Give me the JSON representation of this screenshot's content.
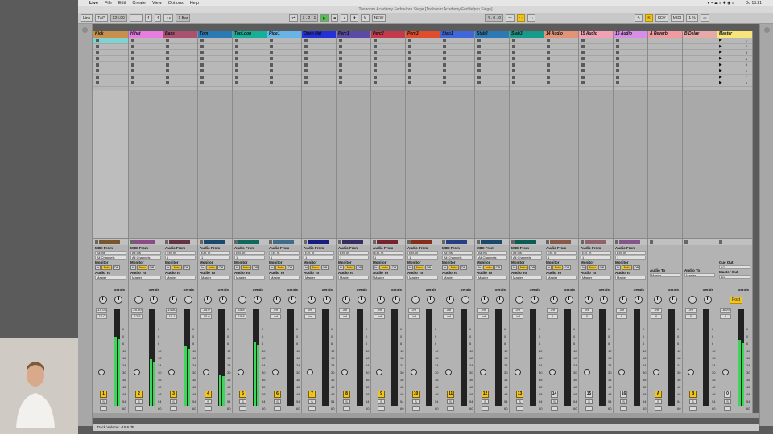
{
  "macbar": {
    "app": "Live",
    "menus": [
      "File",
      "Edit",
      "Create",
      "View",
      "Options",
      "Help"
    ],
    "clock": "Do 13:21"
  },
  "window_title": "Toolroom Academy Fedde/pro Siege [Toolroom Academy Fedde/pro Siege]",
  "toolbar": {
    "link": "Link",
    "tap": "TAP",
    "tempo": "124.00",
    "sig_num": "4",
    "sig_den": "4",
    "quant": "1 Bar",
    "pos": "3 . 2 . 1",
    "new": "NEW",
    "pos2": "4 . 0 . 0",
    "key": "KEY",
    "midi": "MIDI",
    "cpu": "1 %"
  },
  "colors": {
    "accent": "#f2c41f",
    "meter": "#3bd65a"
  },
  "tracks": [
    {
      "name": "Kick",
      "color": "#c8904c",
      "num": "1",
      "vol": "-10.03",
      "peak": "-10.0",
      "lvl": 0.72,
      "type": "midi",
      "from": "MIDI From",
      "sel": "All Ins",
      "ch": "All Channels"
    },
    {
      "name": "Hihat",
      "color": "#e77de0",
      "num": "2",
      "vol": "-20.30",
      "peak": "-12.5",
      "lvl": 0.48,
      "type": "midi",
      "from": "MIDI From",
      "sel": "All Ins",
      "ch": "All Channels"
    },
    {
      "name": "Bass",
      "color": "#a9516f",
      "num": "3",
      "vol": "-14.80",
      "peak": "-15.1",
      "lvl": 0.62,
      "type": "audio",
      "from": "Audio From",
      "sel": "Ext. In",
      "ch": "1"
    },
    {
      "name": "Tom",
      "color": "#2a7ab5",
      "num": "4",
      "vol": "-15.0",
      "peak": "-15.0",
      "lvl": 0.32,
      "type": "audio",
      "from": "Audio From",
      "sel": "Ext. In",
      "ch": "1"
    },
    {
      "name": "TopLoop",
      "color": "#16b098",
      "num": "5",
      "vol": "-15.8",
      "peak": "-15.8",
      "lvl": 0.66,
      "type": "audio",
      "from": "Audio From",
      "sel": "Ext. In",
      "ch": "1"
    },
    {
      "name": "Ride1",
      "color": "#67b4e8",
      "num": "6",
      "vol": "-inf",
      "peak": "-inf",
      "lvl": 0,
      "type": "audio",
      "from": "Audio From",
      "sel": "Ext. In",
      "ch": "1"
    },
    {
      "name": "Open Hat",
      "color": "#2431d6",
      "num": "7",
      "vol": "-inf",
      "peak": "-inf",
      "lvl": 0,
      "type": "audio",
      "from": "Audio From",
      "sel": "Ext. In",
      "ch": "1"
    },
    {
      "name": "Perc1",
      "color": "#5a4aa6",
      "num": "8",
      "vol": "-inf",
      "peak": "-inf",
      "lvl": 0,
      "type": "audio",
      "from": "Audio From",
      "sel": "Ext. In",
      "ch": "1"
    },
    {
      "name": "Perc2",
      "color": "#c33a4b",
      "num": "9",
      "vol": "-inf",
      "peak": "-inf",
      "lvl": 0,
      "type": "audio",
      "from": "Audio From",
      "sel": "Ext. In",
      "ch": "1"
    },
    {
      "name": "Perc3",
      "color": "#e14d2c",
      "num": "10",
      "vol": "-inf",
      "peak": "-inf",
      "lvl": 0,
      "type": "audio",
      "from": "Audio From",
      "sel": "Ext. In",
      "ch": "1"
    },
    {
      "name": "Stab1",
      "color": "#3f67d9",
      "num": "11",
      "vol": "-inf",
      "peak": "-inf",
      "lvl": 0,
      "type": "midi",
      "from": "MIDI From",
      "sel": "All Ins",
      "ch": "All Channels"
    },
    {
      "name": "Stab2",
      "color": "#2a7ab5",
      "num": "12",
      "vol": "-inf",
      "peak": "-inf",
      "lvl": 0,
      "type": "midi",
      "from": "MIDI From",
      "sel": "All Ins",
      "ch": "All Channels"
    },
    {
      "name": "Stab3",
      "color": "#169a8c",
      "num": "13",
      "vol": "-inf",
      "peak": "-inf",
      "lvl": 0,
      "type": "midi",
      "from": "MIDI From",
      "sel": "All Ins",
      "ch": "All Channels"
    },
    {
      "name": "14 Audio",
      "color": "#e39478",
      "num": "14",
      "vol": "-inf",
      "peak": "0",
      "lvl": 0,
      "type": "audio",
      "from": "Audio From",
      "sel": "Ext. In",
      "ch": "1",
      "grey": true
    },
    {
      "name": "15 Audio",
      "color": "#f2a1b4",
      "num": "15",
      "vol": "-inf",
      "peak": "0",
      "lvl": 0,
      "type": "audio",
      "from": "Audio From",
      "sel": "Ext. In",
      "ch": "1",
      "grey": true
    },
    {
      "name": "16 Audio",
      "color": "#d88de8",
      "num": "16",
      "vol": "-inf",
      "peak": "0",
      "lvl": 0,
      "type": "audio",
      "from": "Audio From",
      "sel": "Ext. In",
      "ch": "1",
      "grey": true
    },
    {
      "name": "A Reverb",
      "color": "#f09aa0",
      "num": "A",
      "vol": "-inf",
      "peak": "0",
      "lvl": 0,
      "type": "return"
    },
    {
      "name": "B Delay",
      "color": "#e8a9a9",
      "num": "B",
      "vol": "-inf",
      "peak": "0",
      "lvl": 0,
      "type": "return"
    },
    {
      "name": "Master",
      "color": "#f7e47a",
      "num": "0",
      "vol": "-6.09",
      "peak": "0",
      "lvl": 0.68,
      "type": "master"
    }
  ],
  "labels": {
    "monitor": "Monitor",
    "audio_to": "Audio To",
    "midi_to": "MIDI To",
    "master": "Master",
    "sends": "Sends",
    "in": "In",
    "auto": "Auto",
    "off": "Off",
    "cue_out": "Cue Out",
    "master_out": "Master Out",
    "cue_val": "1/2",
    "mout_val": "1/2",
    "post": "Post"
  },
  "scenes": [
    "1",
    "2",
    "3",
    "4",
    "5",
    "6",
    "7",
    "8"
  ],
  "scale": [
    "6",
    "0",
    "6",
    "12",
    "18",
    "24",
    "30",
    "36",
    "42",
    "48",
    "54",
    "60"
  ],
  "status": "Track Volume: -15.6 dB"
}
